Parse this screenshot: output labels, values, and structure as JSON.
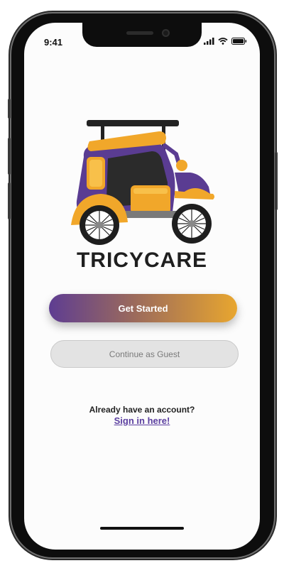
{
  "status_bar": {
    "time": "9:41",
    "icons": [
      "signal-icon",
      "wifi-icon",
      "battery-icon"
    ]
  },
  "app": {
    "logo": "tricycle-logo",
    "name": "TRICYCARE"
  },
  "actions": {
    "get_started_label": "Get Started",
    "guest_label": "Continue as Guest"
  },
  "footer": {
    "account_prompt": "Already have an account?",
    "signin_link": "Sign in here!"
  },
  "colors": {
    "brand_purple": "#5e3d92",
    "brand_orange": "#e8a62f",
    "text_dark": "#1f1f1f"
  }
}
